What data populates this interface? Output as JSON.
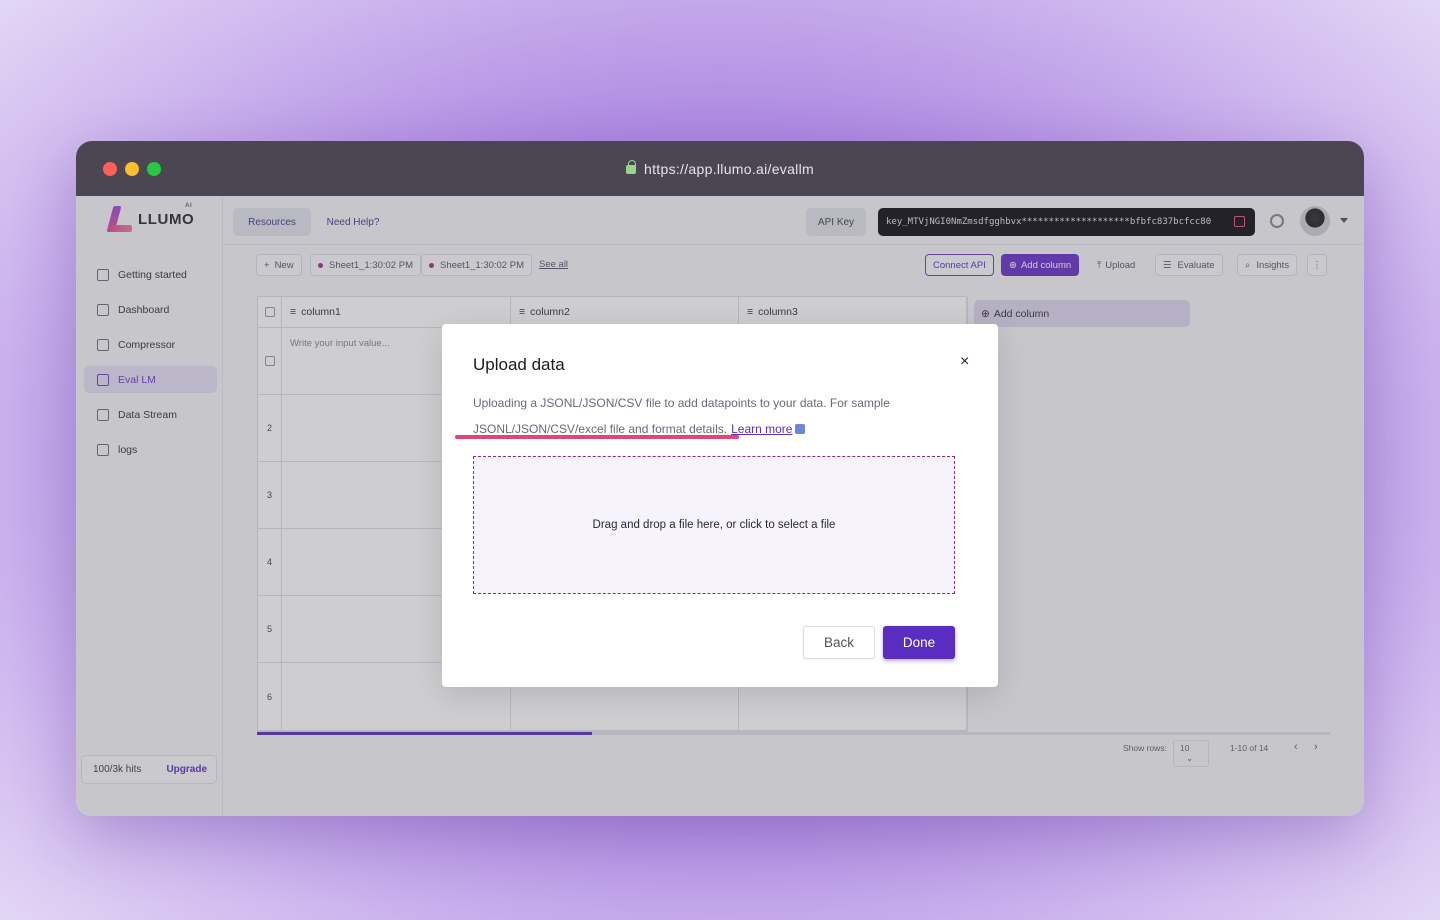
{
  "browser": {
    "url": "https://app.llumo.ai/evallm"
  },
  "logo": {
    "text": "LLUMO",
    "sup": "AI"
  },
  "sidebar": {
    "items": [
      {
        "label": "Getting started",
        "icon": "rocket-icon"
      },
      {
        "label": "Dashboard",
        "icon": "dashboard-icon"
      },
      {
        "label": "Compressor",
        "icon": "compress-icon"
      },
      {
        "label": "Eval LM",
        "icon": "bar-chart-icon",
        "active": true
      },
      {
        "label": "Data Stream",
        "icon": "data-stream-icon"
      },
      {
        "label": "logs",
        "icon": "logs-icon"
      }
    ],
    "hits": "100/3k hits",
    "upgrade": "Upgrade"
  },
  "header": {
    "resources": "Resources",
    "need_help": "Need Help?",
    "api_key_label": "API Key",
    "api_key_value": "key_MTVjNGI0NmZmsdfgghbvx********************bfbfc837bcfcc80"
  },
  "toolbar": {
    "new": "New",
    "sheet1": "Sheet1_1:30:02 PM",
    "sheet2": "Sheet1_1:30:02 PM",
    "see_all": "See all",
    "connect_api": "Connect API",
    "add_column": "Add column",
    "upload": "Upload",
    "evaluate": "Evaluate",
    "insights": "Insights"
  },
  "table": {
    "columns": [
      "column1",
      "column2",
      "column3"
    ],
    "placeholder": "Write your input value...",
    "rows": [
      "2",
      "3",
      "4",
      "5",
      "6"
    ],
    "add_column": "Add column"
  },
  "pagination": {
    "show_rows_label": "Show rows:",
    "rows_value": "10",
    "range": "1-10 of 14"
  },
  "modal": {
    "title": "Upload data",
    "desc_line1": "Uploading a JSONL/JSON/CSV file to add datapoints to your data. For sample",
    "desc_line2": "JSONL/JSON/CSV/excel file and format details.",
    "learn_more": "Learn more",
    "dropzone": "Drag and drop a file here, or click to select a file",
    "back": "Back",
    "done": "Done",
    "close": "×"
  },
  "colors": {
    "accent": "#5a2dc2",
    "dropzone_border": "#8b2d82",
    "highlight": "#e2457a"
  }
}
